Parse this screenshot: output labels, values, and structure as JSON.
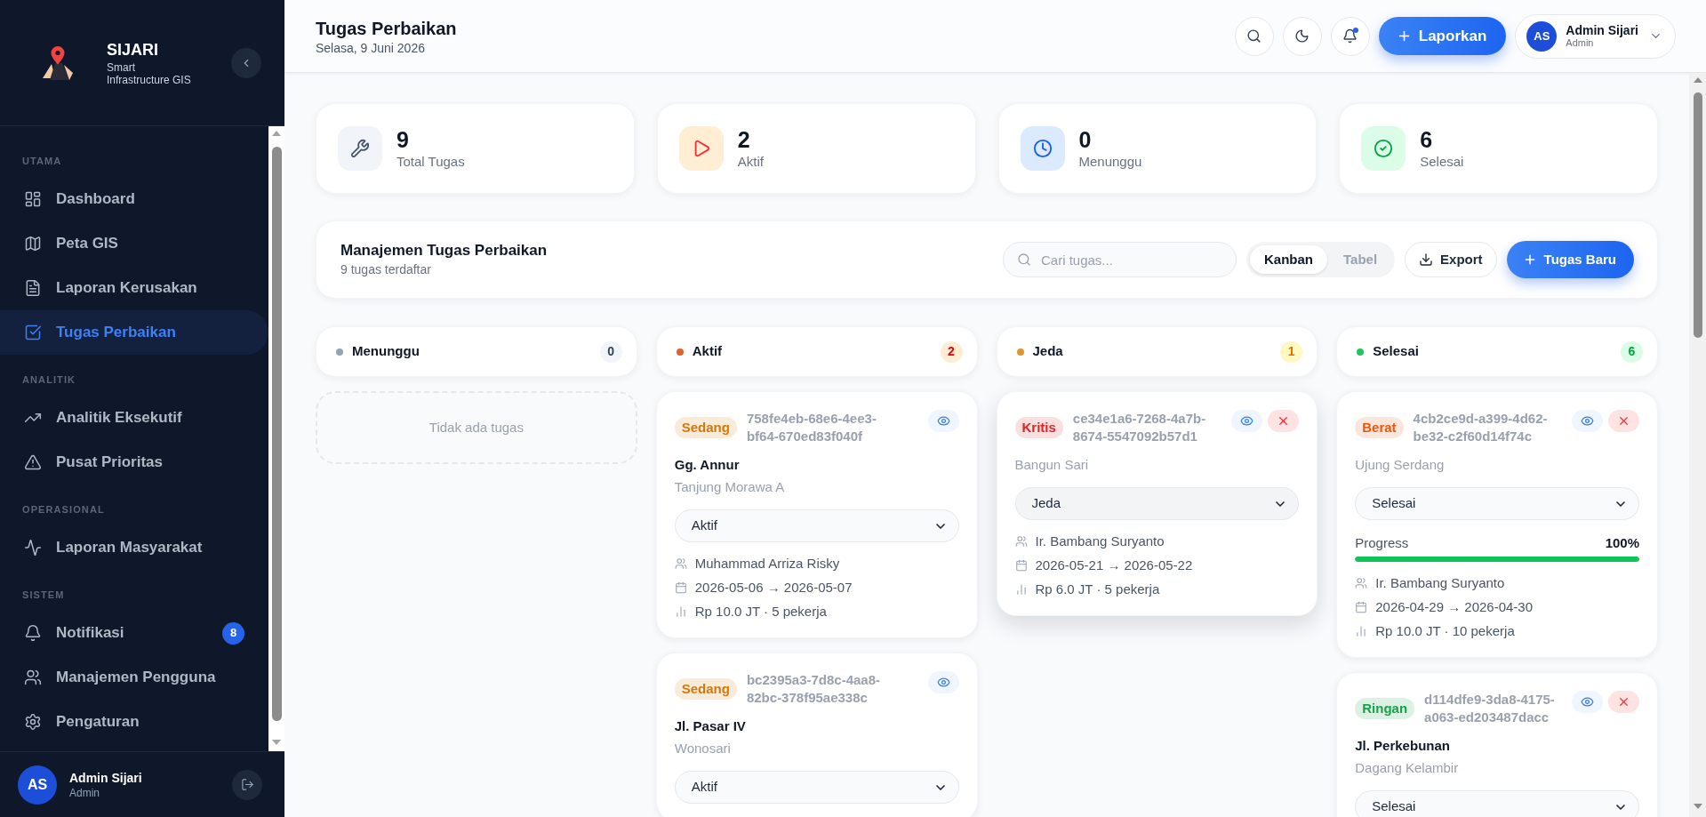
{
  "sidebar": {
    "brand": {
      "name": "SIJARI",
      "tagline": "Smart Infrastructure GIS"
    },
    "sections": [
      {
        "title": "UTAMA",
        "items": [
          {
            "label": "Dashboard",
            "selected": false
          },
          {
            "label": "Peta GIS",
            "selected": false
          },
          {
            "label": "Laporan Kerusakan",
            "selected": false
          },
          {
            "label": "Tugas Perbaikan",
            "selected": true
          }
        ]
      },
      {
        "title": "ANALITIK",
        "items": [
          {
            "label": "Analitik Eksekutif",
            "selected": false
          },
          {
            "label": "Pusat Prioritas",
            "selected": false
          }
        ]
      },
      {
        "title": "OPERASIONAL",
        "items": [
          {
            "label": "Laporan Masyarakat",
            "selected": false
          }
        ]
      },
      {
        "title": "SISTEM",
        "items": [
          {
            "label": "Notifikasi",
            "selected": false,
            "badge": "8"
          },
          {
            "label": "Manajemen Pengguna",
            "selected": false
          },
          {
            "label": "Pengaturan",
            "selected": false
          }
        ]
      }
    ],
    "user": {
      "initials": "AS",
      "name": "Admin Sijari",
      "role": "Admin"
    }
  },
  "header": {
    "title": "Tugas Perbaikan",
    "date": "Selasa, 9 Juni 2026",
    "unread_notifications": true,
    "report_button": "Laporkan",
    "user": {
      "initials": "AS",
      "name": "Admin Sijari",
      "role": "Admin"
    }
  },
  "stats": [
    {
      "kind": "total",
      "value": "9",
      "label": "Total Tugas"
    },
    {
      "kind": "active",
      "value": "2",
      "label": "Aktif"
    },
    {
      "kind": "waiting",
      "value": "0",
      "label": "Menunggu"
    },
    {
      "kind": "done",
      "value": "6",
      "label": "Selesai"
    }
  ],
  "toolbar": {
    "title": "Manajemen Tugas Perbaikan",
    "subtitle": "9 tugas terdaftar",
    "search": {
      "placeholder": "Cari tugas..."
    },
    "views": [
      {
        "label": "Kanban",
        "selected": true
      },
      {
        "label": "Tabel",
        "selected": false
      }
    ],
    "export_button": "Export",
    "new_button": "Tugas Baru"
  },
  "columns": [
    {
      "kind": "waiting",
      "title": "Menunggu",
      "count": "0",
      "color": "#94a3b8",
      "empty_text": "Tidak ada tugas"
    },
    {
      "kind": "active",
      "title": "Aktif",
      "count": "2",
      "color": "#e0622a",
      "cards": [
        {
          "severity": {
            "label": "Sedang",
            "color": "#d97706"
          },
          "id": "758fe4eb-68e6-4ee3-bf64-670ed83f040f",
          "title": "Gg. Annur",
          "location": "Tanjung Morawa A",
          "status": "Aktif",
          "assignee": "Muhammad Arriza Risky",
          "dates": "2026-05-06 → 2026-05-07",
          "cost": "Rp 10.0 JT · 5 pekerja",
          "deletable": false,
          "hovered": false
        },
        {
          "severity": {
            "label": "Sedang",
            "color": "#d97706"
          },
          "id": "bc2395a3-7d8c-4aa8-82bc-378f95ae338c",
          "title": "Jl. Pasar IV",
          "location": "Wonosari",
          "status": "Aktif",
          "deletable": false,
          "hovered": false
        }
      ]
    },
    {
      "kind": "paused",
      "title": "Jeda",
      "count": "1",
      "color": "#e0952f",
      "cards": [
        {
          "severity": {
            "label": "Kritis",
            "color": "#dc2626"
          },
          "id": "ce34e1a6-7268-4a7b-8674-5547092b57d1",
          "location": "Bangun Sari",
          "status": "Jeda",
          "assignee": "Ir. Bambang Suryanto",
          "dates": "2026-05-21 → 2026-05-22",
          "cost": "Rp 6.0 JT · 5 pekerja",
          "deletable": true,
          "hovered": true
        }
      ]
    },
    {
      "kind": "done",
      "title": "Selesai",
      "count": "6",
      "color": "#22c55e",
      "cards": [
        {
          "severity": {
            "label": "Berat",
            "color": "#ea580c"
          },
          "id": "4cb2ce9d-a399-4d62-be32-c2f60d14f74c",
          "location": "Ujung Serdang",
          "status": "Selesai",
          "progress": {
            "label": "Progress",
            "reading": "100%",
            "level": 1
          },
          "assignee": "Ir. Bambang Suryanto",
          "dates": "2026-04-29 → 2026-04-30",
          "cost": "Rp 10.0 JT · 10 pekerja",
          "deletable": true,
          "hovered": false
        },
        {
          "severity": {
            "label": "Ringan",
            "color": "#16a34a"
          },
          "id": "d114dfe9-3da8-4175-a063-ed203487dacc",
          "title": "Jl. Perkebunan",
          "location": "Dagang Kelambir",
          "status": "Selesai",
          "deletable": true,
          "hovered": false
        }
      ]
    }
  ]
}
